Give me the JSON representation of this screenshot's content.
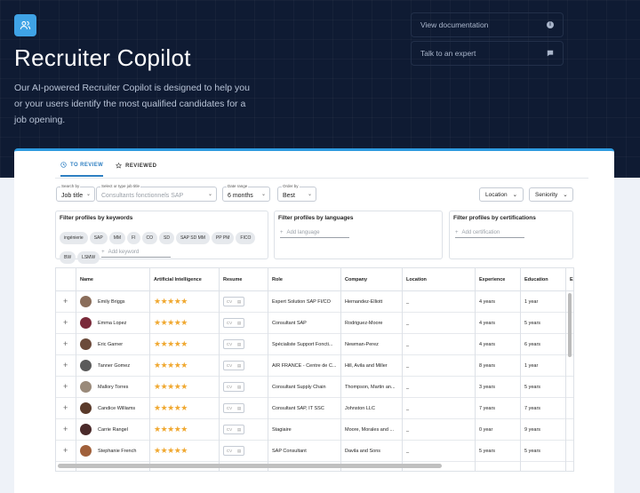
{
  "header": {
    "title": "Recruiter Copilot",
    "description": "Our AI-powered Recruiter Copilot is designed to help you or your users identify the most qualified candidates for a job opening.",
    "links": [
      {
        "label": "View documentation",
        "icon": "info-icon"
      },
      {
        "label": "Talk to an expert",
        "icon": "chat-icon"
      }
    ],
    "logo_icon": "users-icon",
    "accent": "#3fa3e6",
    "background": "#0f1b33"
  },
  "tabs": [
    {
      "label": "TO REVIEW",
      "icon": "clock-icon",
      "active": true
    },
    {
      "label": "REVIEWED",
      "icon": "star-icon",
      "active": false
    }
  ],
  "filters": {
    "search_by": {
      "label": "Search by",
      "value": "Job title"
    },
    "job_title": {
      "label": "Select or type job title",
      "value": "Consultants fonctionnels SAP"
    },
    "date_range": {
      "label": "Date range",
      "value": "6 months"
    },
    "order_by": {
      "label": "Order by",
      "value": "Best"
    },
    "location": "Location",
    "seniority": "Seniority"
  },
  "keywords": {
    "title": "Filter profiles by keywords",
    "chips": [
      "ingénierie",
      "SAP",
      "MM",
      "FI",
      "CO",
      "SD",
      "SAP SD MM",
      "PP PM",
      "FICO",
      "BW",
      "LSMW"
    ],
    "add_placeholder": "Add keyword"
  },
  "languages": {
    "title": "Filter profiles by languages",
    "add_placeholder": "Add language"
  },
  "certifications": {
    "title": "Filter profiles by certifications",
    "add_placeholder": "Add certification"
  },
  "table": {
    "columns": [
      "Name",
      "Artificial Intelligence",
      "Resume",
      "Role",
      "Company",
      "Location",
      "Experience",
      "Education",
      "En"
    ],
    "resume_label": "CV",
    "rating_color": "#f0a830",
    "rows": [
      {
        "name": "Emily Briggs",
        "stars": 5,
        "role": "Expert Solution SAP FI/CO",
        "company": "Hernandez-Elliott",
        "location": "_",
        "experience": "4 years",
        "education": "1 year",
        "avatar_color": "#8a6d5a"
      },
      {
        "name": "Emma Lopez",
        "stars": 5,
        "role": "Consultant SAP",
        "company": "Rodriguez-Moore",
        "location": "_",
        "experience": "4 years",
        "education": "5 years",
        "avatar_color": "#7a2a3a"
      },
      {
        "name": "Eric Garner",
        "stars": 5,
        "role": "Spécialiste Support Foncti...",
        "company": "Newman-Perez",
        "location": "_",
        "experience": "4 years",
        "education": "6 years",
        "avatar_color": "#6b4a3a"
      },
      {
        "name": "Tanner Gomez",
        "stars": 5,
        "role": "AIR FRANCE - Centre de C...",
        "company": "Hill, Avila and Miller",
        "location": "_",
        "experience": "8 years",
        "education": "1 year",
        "avatar_color": "#5a5a5a"
      },
      {
        "name": "Mallory Torres",
        "stars": 5,
        "role": "Consultant Supply Chain",
        "company": "Thompson, Martin an...",
        "location": "_",
        "experience": "3 years",
        "education": "5 years",
        "avatar_color": "#9a8a7a"
      },
      {
        "name": "Candice Williams",
        "stars": 5,
        "role": "Consultant SAP, IT SSC",
        "company": "Johnston LLC",
        "location": "_",
        "experience": "7 years",
        "education": "7 years",
        "avatar_color": "#5a3a2a"
      },
      {
        "name": "Carrie Rangel",
        "stars": 5,
        "role": "Stagiaire",
        "company": "Moore, Morales and ...",
        "location": "_",
        "experience": "0 year",
        "education": "9 years",
        "avatar_color": "#4a2a2a"
      },
      {
        "name": "Stephanie French",
        "stars": 5,
        "role": "SAP Consultant",
        "company": "Davila and Sons",
        "location": "_",
        "experience": "5 years",
        "education": "5 years",
        "avatar_color": "#a0603a"
      }
    ]
  }
}
